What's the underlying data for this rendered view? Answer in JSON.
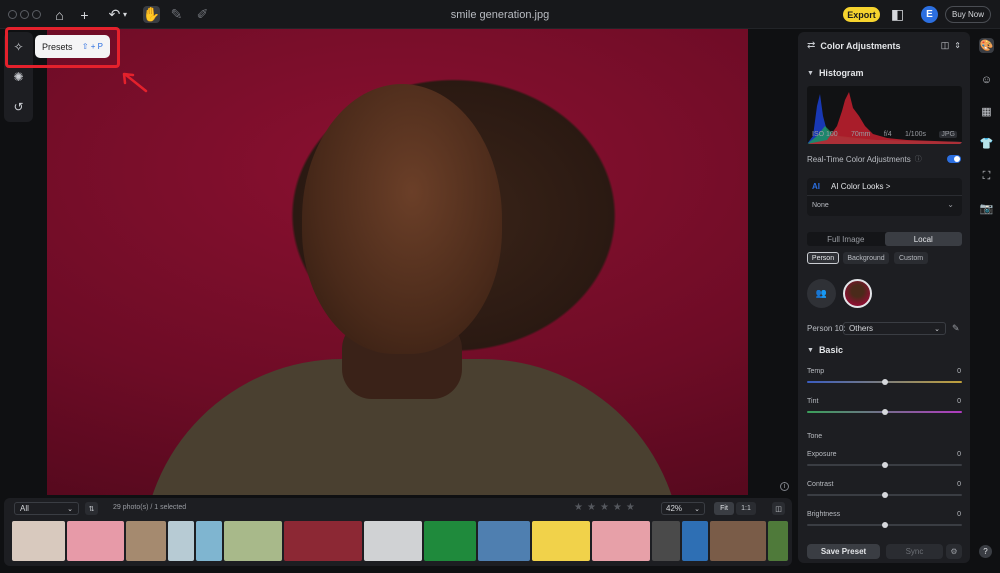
{
  "window": {
    "title": "smile generation.jpg"
  },
  "toolbar": {
    "export_label": "Export",
    "avatar_initial": "E",
    "buy_label": "Buy Now"
  },
  "tooltip": {
    "label": "Presets",
    "shortcut": "⇧ + P"
  },
  "panel": {
    "title": "Color Adjustments",
    "histogram": {
      "title": "Histogram",
      "iso": "ISO 100",
      "focal": "70mm",
      "aperture": "f/4",
      "shutter": "1/100s",
      "format": "JPG"
    },
    "realtime": {
      "label": "Real-Time Color Adjustments",
      "enabled": true
    },
    "ai_looks": {
      "label": "AI Color Looks >",
      "badge": "AI",
      "value": "None"
    },
    "segment": {
      "options": [
        "Full Image",
        "Local"
      ],
      "selected": "Local"
    },
    "chips": {
      "items": [
        "Person",
        "Background",
        "Custom"
      ],
      "selected": "Person"
    },
    "person": {
      "label": "Person 10:",
      "value": "Others"
    },
    "basic": {
      "title": "Basic"
    },
    "sliders": [
      {
        "label": "Temp",
        "value": "0"
      },
      {
        "label": "Tint",
        "value": "0"
      },
      {
        "label": "Exposure",
        "value": "0"
      },
      {
        "label": "Contrast",
        "value": "0"
      },
      {
        "label": "Brightness",
        "value": "0"
      }
    ],
    "tone_label": "Tone",
    "save_label": "Save Preset",
    "sync_label": "Sync"
  },
  "filmstrip": {
    "filter_value": "All",
    "count_text": "29 photo(s) / 1 selected",
    "zoom_value": "42%",
    "fit_label": "Fit",
    "one_label": "1:1",
    "thumb_colors": [
      "#d8c9be",
      "#e79aa8",
      "#a58a6f",
      "#b7cbd4",
      "#7fb5d0",
      "#a8b98a",
      "#8c2834",
      "#d0d2d4",
      "#1f8a3c",
      "#4f7fb0",
      "#f1d24a",
      "#e7a0a8",
      "#4a4a4a",
      "#2e6fb4",
      "#7a5c48",
      "#4f7a3a"
    ],
    "thumb_widths": [
      53,
      57,
      40,
      26,
      26,
      58,
      78,
      58,
      52,
      52,
      58,
      58,
      28,
      26,
      56,
      20
    ],
    "stars": 5
  },
  "colors": {
    "accent": "#2c6fe0",
    "export": "#f6d32e",
    "highlight": "#e4212c",
    "background": "#6e0c26"
  }
}
